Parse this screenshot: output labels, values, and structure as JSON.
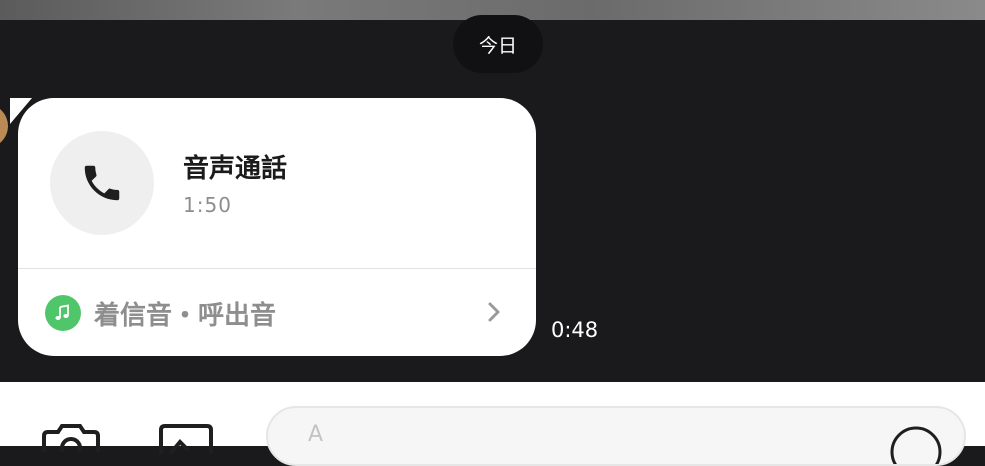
{
  "chat": {
    "date_separator": "今日",
    "call_message": {
      "title": "音声通話",
      "duration": "1:50",
      "ringtone_label": "着信音・呼出音",
      "icon": "phone-icon",
      "ringtone_icon": "music-note-icon",
      "accent_color": "#4fc66a"
    },
    "timestamp": "0:48"
  },
  "composer": {
    "camera_icon": "camera-icon",
    "image_icon": "image-icon",
    "input_placeholder_glyph": "A",
    "emoji_icon": "emoji-icon"
  },
  "colors": {
    "background": "#1a1a1c",
    "bubble": "#ffffff",
    "muted_text": "#8e8e8e"
  }
}
